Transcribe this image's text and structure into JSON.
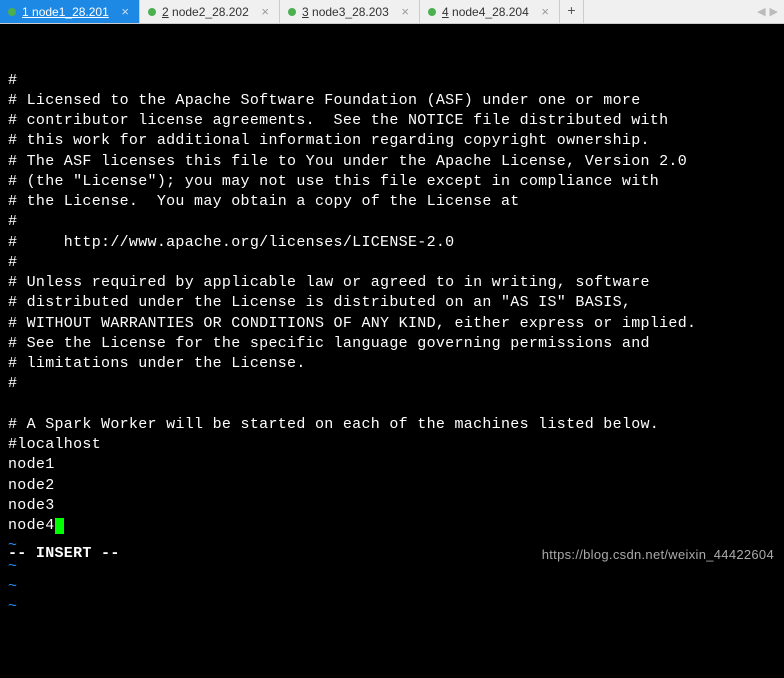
{
  "tabs": [
    {
      "num": "1",
      "label": "node1_28.201",
      "active": true
    },
    {
      "num": "2",
      "label": "node2_28.202",
      "active": false
    },
    {
      "num": "3",
      "label": "node3_28.203",
      "active": false
    },
    {
      "num": "4",
      "label": "node4_28.204",
      "active": false
    }
  ],
  "tab_add": "+",
  "tab_close": "×",
  "nav": {
    "left": "◀",
    "right": "▶"
  },
  "editor_lines": [
    "#",
    "# Licensed to the Apache Software Foundation (ASF) under one or more",
    "# contributor license agreements.  See the NOTICE file distributed with",
    "# this work for additional information regarding copyright ownership.",
    "# The ASF licenses this file to You under the Apache License, Version 2.0",
    "# (the \"License\"); you may not use this file except in compliance with",
    "# the License.  You may obtain a copy of the License at",
    "#",
    "#     http://www.apache.org/licenses/LICENSE-2.0",
    "#",
    "# Unless required by applicable law or agreed to in writing, software",
    "# distributed under the License is distributed on an \"AS IS\" BASIS,",
    "# WITHOUT WARRANTIES OR CONDITIONS OF ANY KIND, either express or implied.",
    "# See the License for the specific language governing permissions and",
    "# limitations under the License.",
    "#",
    "",
    "# A Spark Worker will be started on each of the machines listed below.",
    "#localhost",
    "node1",
    "node2",
    "node3",
    "node4"
  ],
  "tilde": "~",
  "status": "-- INSERT --",
  "watermark": "https://blog.csdn.net/weixin_44422604"
}
